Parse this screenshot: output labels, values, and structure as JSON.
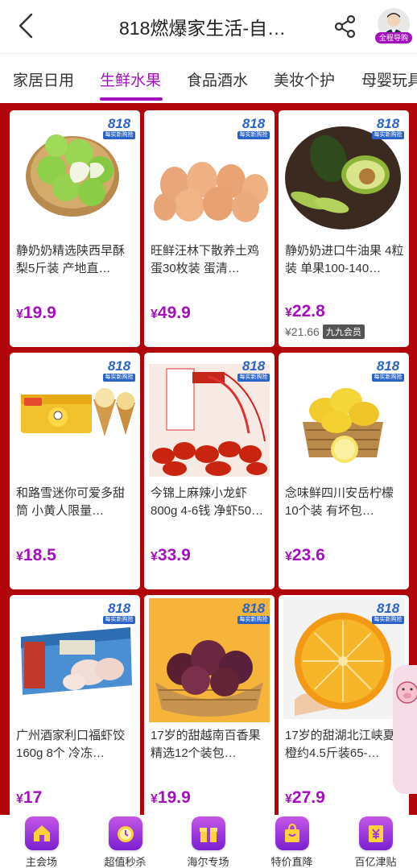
{
  "header": {
    "title": "818燃爆家生活-自…",
    "avatar_badge": "全程导购"
  },
  "tabs": [
    {
      "label": "家居日用",
      "active": false
    },
    {
      "label": "生鲜水果",
      "active": true
    },
    {
      "label": "食品酒水",
      "active": false
    },
    {
      "label": "美妆个护",
      "active": false
    },
    {
      "label": "母婴玩具",
      "active": false
    }
  ],
  "badge": {
    "num": "818",
    "sub": "每实新购抢"
  },
  "products": [
    {
      "name": "静奶奶精选陕西早酥梨5斤装 产地直…",
      "price": "19.9",
      "img": "pear-image"
    },
    {
      "name": "旺鲜汪林下散养土鸡蛋30枚装 蛋清…",
      "price": "49.9",
      "img": "egg-image"
    },
    {
      "name": "静奶奶进口牛油果 4粒装 单果100-140…",
      "price": "22.8",
      "member_price": "¥21.66",
      "member_tag": "九九会员",
      "img": "avocado-image"
    },
    {
      "name": "和路雪迷你可爱多甜筒 小黄人限量…",
      "price": "18.5",
      "img": "icecream-image"
    },
    {
      "name": "今锦上麻辣小龙虾 800g 4-6钱 净虾50…",
      "price": "33.9",
      "img": "crayfish-image"
    },
    {
      "name": "念味鲜四川安岳柠檬10个装 有坏包…",
      "price": "23.6",
      "img": "lemon-image"
    },
    {
      "name": "广州酒家利口福虾饺 160g 8个 冷冻…",
      "price": "17",
      "img": "dumpling-image"
    },
    {
      "name": "17岁的甜越南百香果精选12个装包…",
      "price": "19.9",
      "img": "passionfruit-image"
    },
    {
      "name": "17岁的甜湖北江峡夏橙约4.5斤装65-…",
      "price": "27.9",
      "img": "orange-image"
    }
  ],
  "currency": "¥",
  "bottom_nav": [
    {
      "label": "主会场",
      "icon": "home-icon"
    },
    {
      "label": "超值秒杀",
      "icon": "alarm-clock-icon"
    },
    {
      "label": "海尔专场",
      "icon": "gift-icon"
    },
    {
      "label": "特价直降",
      "icon": "shopping-bag-icon"
    },
    {
      "label": "百亿津贴",
      "icon": "yen-card-icon"
    }
  ]
}
